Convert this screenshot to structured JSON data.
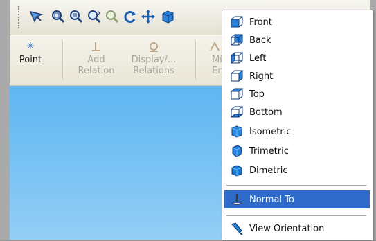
{
  "ribbon": {
    "point_label": "Point",
    "add_relation_line1": "Add",
    "add_relation_line2": "Relation",
    "display_relations_line1": "Display/...",
    "display_relations_line2": "Relations",
    "mirror_line1": "Mir",
    "mirror_line2": "Enti"
  },
  "toolbar": {
    "icons": [
      "previous-view-icon",
      "zoom-to-fit-icon",
      "zoom-to-area-icon",
      "zoom-in-out-icon",
      "zoom-to-selection-icon",
      "rotate-view-icon",
      "pan-icon",
      "view-orientation-icon"
    ]
  },
  "menu": {
    "items": [
      {
        "label": "Front"
      },
      {
        "label": "Back"
      },
      {
        "label": "Left"
      },
      {
        "label": "Right"
      },
      {
        "label": "Top"
      },
      {
        "label": "Bottom"
      },
      {
        "label": "Isometric"
      },
      {
        "label": "Trimetric"
      },
      {
        "label": "Dimetric"
      }
    ],
    "normal_to": "Normal To",
    "view_orientation": "View Orientation"
  },
  "colors": {
    "viewport_top": "#5fb6f2",
    "selection": "#2f6bc9",
    "cube_blue": "#2a7fd4"
  }
}
